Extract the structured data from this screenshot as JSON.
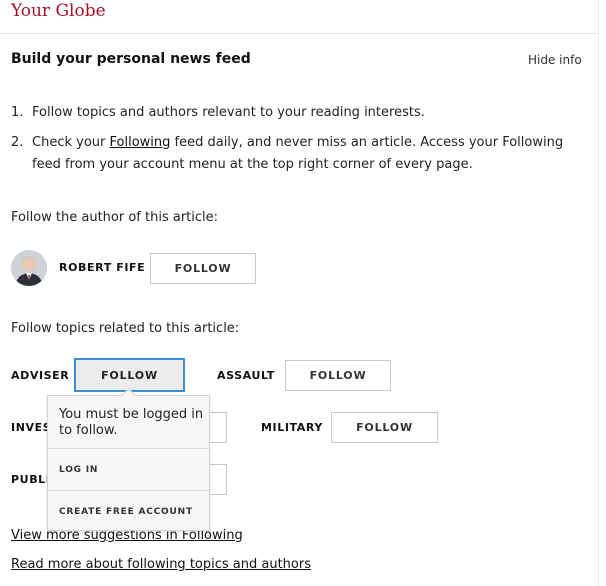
{
  "header": {
    "title": "Your Globe"
  },
  "feed_info": {
    "title": "Build your personal news feed",
    "hide_label": "Hide info",
    "steps": [
      {
        "num": "1.",
        "text": "Follow topics and authors relevant to your reading interests."
      },
      {
        "num": "2.",
        "text_before": "Check your ",
        "link": "Following",
        "text_after": " feed daily, and never miss an article. Access your Following feed from your account menu at the top right corner of every page."
      }
    ]
  },
  "author_section": {
    "label": "Follow the author of this article:",
    "author_name": "ROBERT FIFE",
    "follow_label": "FOLLOW"
  },
  "topics_section": {
    "label": "Follow topics related to this article:",
    "topics": [
      {
        "name": "ADVISER",
        "follow_label": "FOLLOW"
      },
      {
        "name": "ASSAULT",
        "follow_label": "FOLLOW"
      },
      {
        "name": "INVES",
        "follow_label": ""
      },
      {
        "name": "MILITARY",
        "follow_label": "FOLLOW"
      },
      {
        "name": "PUBLI",
        "follow_label": ""
      }
    ]
  },
  "login_tooltip": {
    "message": "You must be logged in to follow.",
    "login_label": "LOG IN",
    "create_account_label": "CREATE FREE ACCOUNT"
  },
  "links": {
    "view_more": "View more suggestions in Following",
    "read_more": "Read more about following topics and authors"
  },
  "colors": {
    "brand_red": "#a8102a",
    "focus_blue": "#3b8fce"
  }
}
